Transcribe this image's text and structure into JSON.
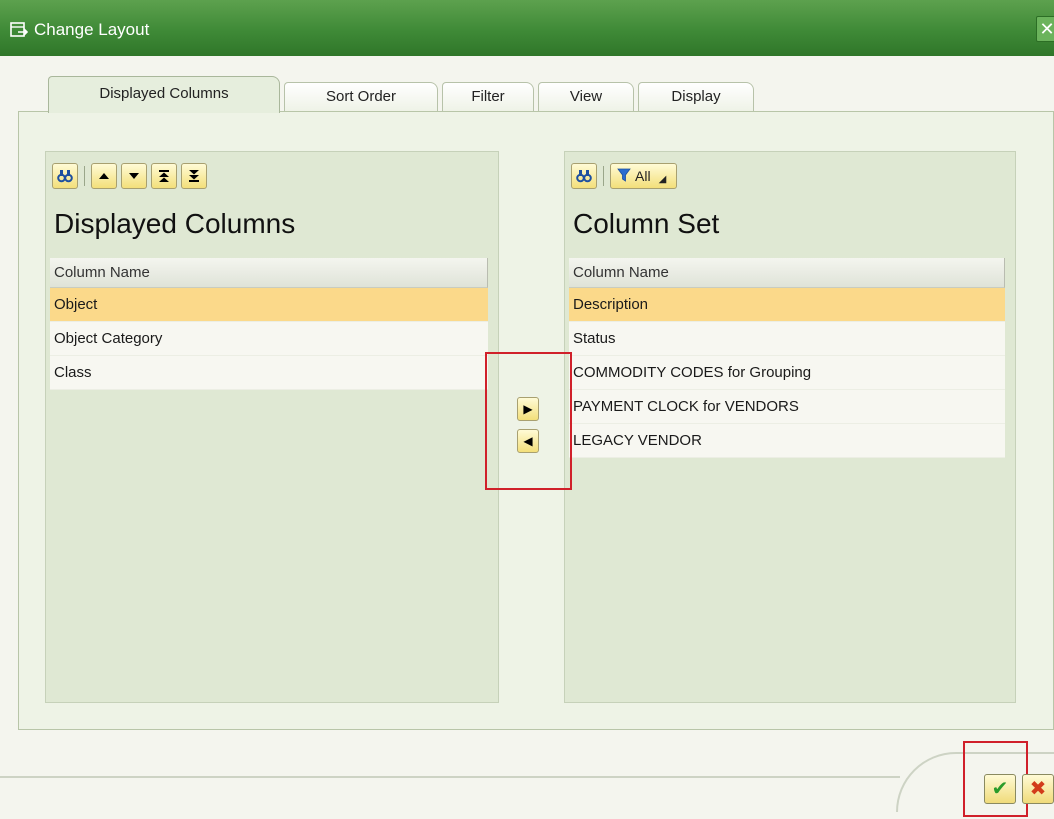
{
  "window": {
    "title": "Change Layout",
    "close_glyph": "✕"
  },
  "tabs": [
    {
      "label": "Displayed Columns"
    },
    {
      "label": "Sort Order"
    },
    {
      "label": "Filter"
    },
    {
      "label": "View"
    },
    {
      "label": "Display"
    }
  ],
  "left": {
    "title": "Displayed Columns",
    "column_header": "Column Name",
    "rows": [
      "Object",
      "Object Category",
      "Class"
    ],
    "selected_row": "Object",
    "toolbar_icons": [
      "find-icon",
      "move-up-icon",
      "move-down-icon",
      "move-top-icon",
      "move-bottom-icon"
    ]
  },
  "right": {
    "title": "Column Set",
    "column_header": "Column Name",
    "rows": [
      "Description",
      "Status",
      "COMMODITY CODES for Grouping",
      "PAYMENT CLOCK for VENDORS",
      "LEGACY VENDOR"
    ],
    "selected_row": "Description",
    "filter_label": "All",
    "toolbar_icons": [
      "find-icon",
      "filter-icon"
    ]
  },
  "move": {
    "add_glyph": "▶",
    "remove_glyph": "◀"
  },
  "footer": {
    "ok_glyph": "✔",
    "cancel_glyph": "✖"
  },
  "colors": {
    "titlebar": "#3f8a37",
    "selection": "#fbd98a",
    "highlight_box": "#d0202a"
  }
}
